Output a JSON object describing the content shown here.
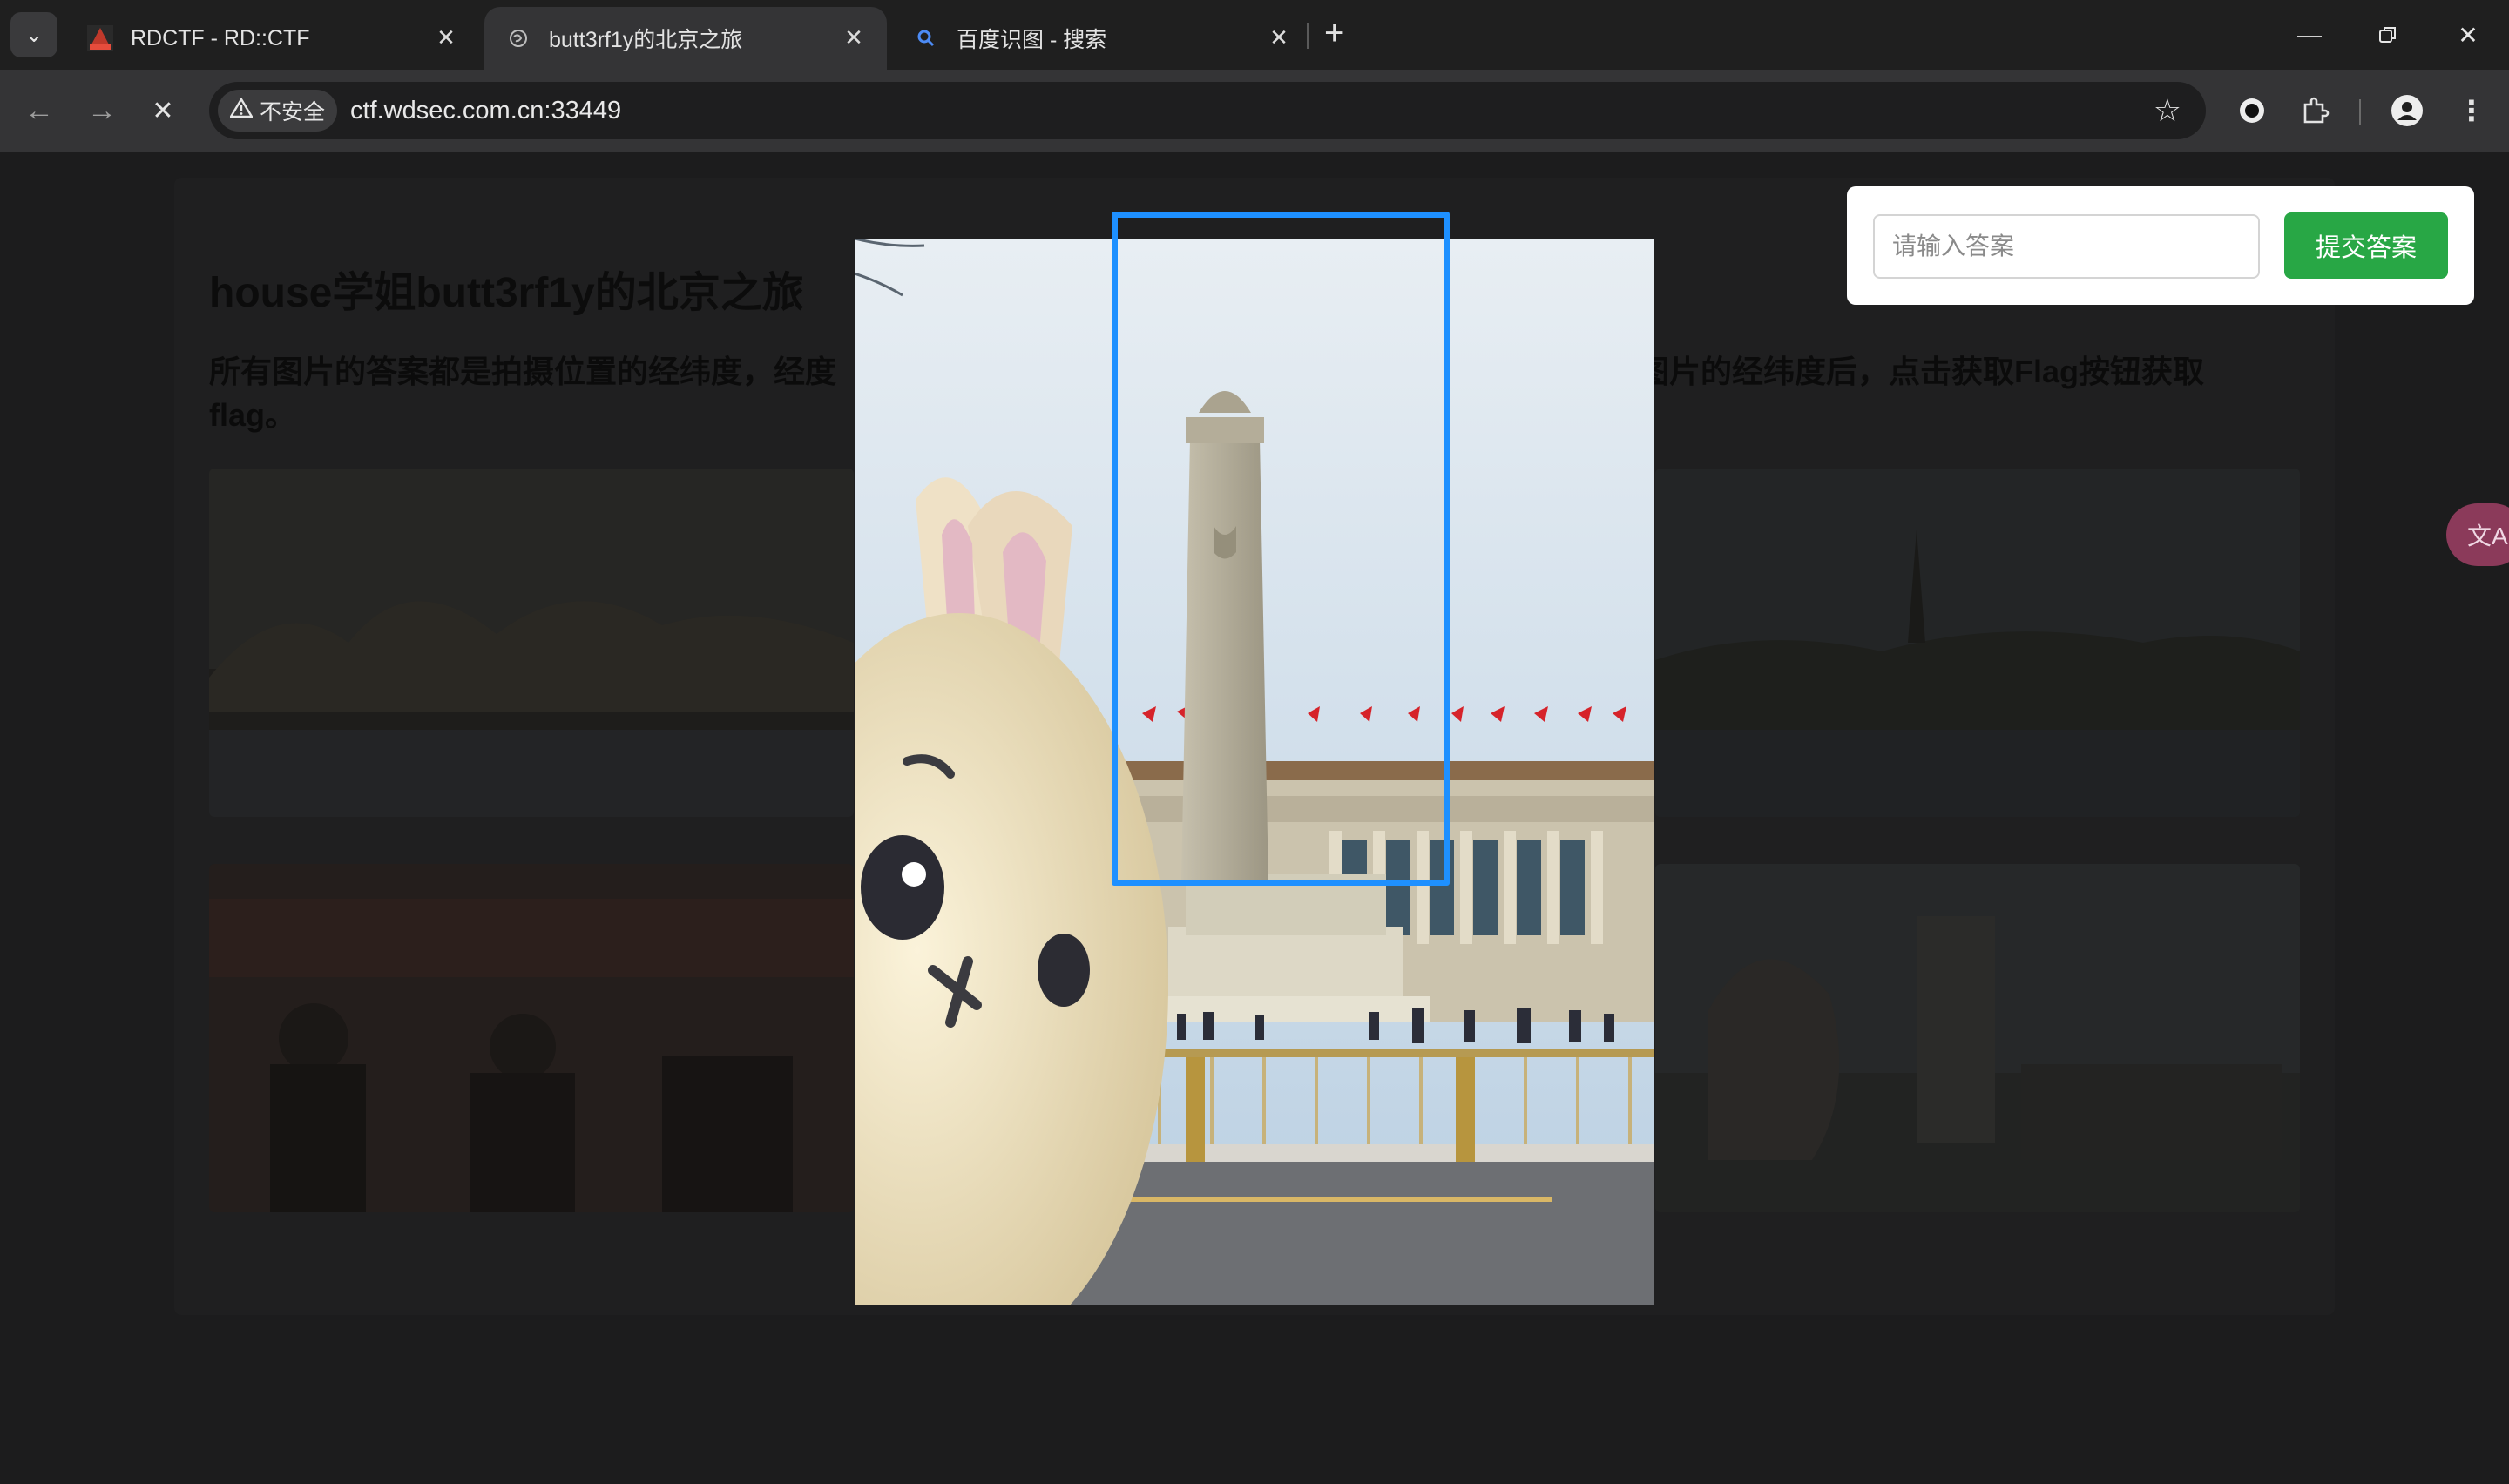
{
  "browser": {
    "tabs": [
      {
        "title": "RDCTF - RD::CTF",
        "favicon": "rdctf-logo-icon",
        "active": false
      },
      {
        "title": "butt3rf1y的北京之旅",
        "favicon": "globe-icon",
        "active": true
      },
      {
        "title": "百度识图 - 搜索",
        "favicon": "search-icon",
        "active": false
      }
    ],
    "security_label": "不安全",
    "url": "ctf.wdsec.com.cn:33449"
  },
  "page": {
    "title": "house学姐butt3rf1y的北京之旅",
    "description_part1": "所有图片的答案都是拍摄位置的经纬度，经度",
    "description_part2": "图片的经纬度后，点击获取Flag按钮获取",
    "description_line2": "flag。"
  },
  "answer_form": {
    "placeholder": "请输入答案",
    "submit_label": "提交答案",
    "accent_color": "#28a745"
  },
  "selection_box_color": "#1e90ff"
}
